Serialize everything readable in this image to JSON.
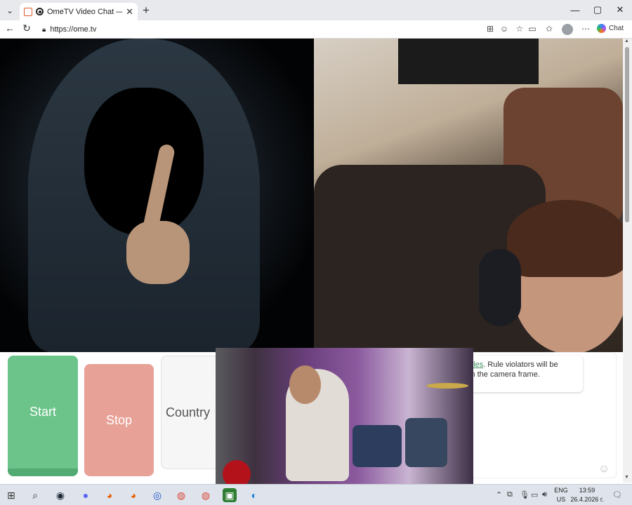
{
  "browser": {
    "tab_title": "OmeTV Video Chat — Omegle",
    "tab_close": "✕",
    "new_tab": "+",
    "url": "https://ome.tv",
    "chat_label": "Chat",
    "window_controls": {
      "minimize": "—",
      "maximize": "▢",
      "close": "✕"
    }
  },
  "controls": {
    "start_label": "Start",
    "stop_label": "Stop",
    "country_label": "Country",
    "start_color": "#6cc48b",
    "stop_color": "#e8a196"
  },
  "chat": {
    "notice_link": "ules",
    "notice_rest_1": ". Rule violators will be",
    "notice_rest_2": "in the camera frame."
  },
  "taskbar": {
    "lang_top": "ENG",
    "lang_bottom": "US",
    "time": "13:59",
    "date": "26.4.2026 г."
  },
  "icons": [
    "windows-logo-icon",
    "search-icon",
    "steam-icon",
    "discord-icon",
    "firefox-icon",
    "firefox-icon",
    "ea-icon",
    "chrome-icon",
    "chrome-icon",
    "android-icon",
    "edge-icon"
  ]
}
